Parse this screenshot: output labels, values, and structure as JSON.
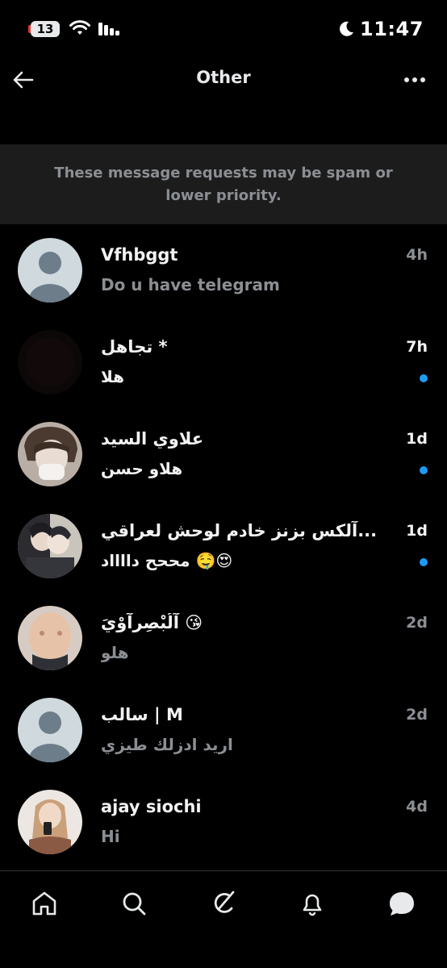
{
  "status_bar": {
    "battery": "13",
    "time": "11:47"
  },
  "header": {
    "title": "Other"
  },
  "notice": {
    "text": "These message requests may be spam or lower priority."
  },
  "conversations": [
    {
      "name": "Vfhbggt",
      "preview": "Do u have telegram",
      "time": "4h",
      "unread": false,
      "avatar": "default-avatar"
    },
    {
      "name": "تجاهلٍ *",
      "preview": "هلا",
      "time": "7h",
      "unread": true,
      "avatar": "dark-photo"
    },
    {
      "name": "علاوي السيد",
      "preview": "هلاو حسن",
      "time": "1d",
      "unread": true,
      "avatar": "photo"
    },
    {
      "name": "آلكس بزنز خادم لوحش لعراقي...",
      "preview": "مححح دااااد 🤤😍",
      "time": "1d",
      "unread": true,
      "avatar": "photo"
    },
    {
      "name": "آلُبْصِرآوْيَ 😘",
      "preview": "هلو",
      "time": "2d",
      "unread": false,
      "avatar": "photo"
    },
    {
      "name": "سالب | M",
      "preview": "اريد ادزلك طيزي",
      "time": "2d",
      "unread": false,
      "avatar": "default-avatar"
    },
    {
      "name": "ajay siochi",
      "preview": "Hi",
      "time": "4d",
      "unread": false,
      "avatar": "photo"
    }
  ],
  "nav": [
    "home-icon",
    "search-icon",
    "grok-icon",
    "notifications-icon",
    "messages-icon"
  ],
  "colors": {
    "background": "#000000",
    "accent": "#1d9bf0",
    "muted": "#8b8f93",
    "notice_bg": "#1c1c1c"
  }
}
